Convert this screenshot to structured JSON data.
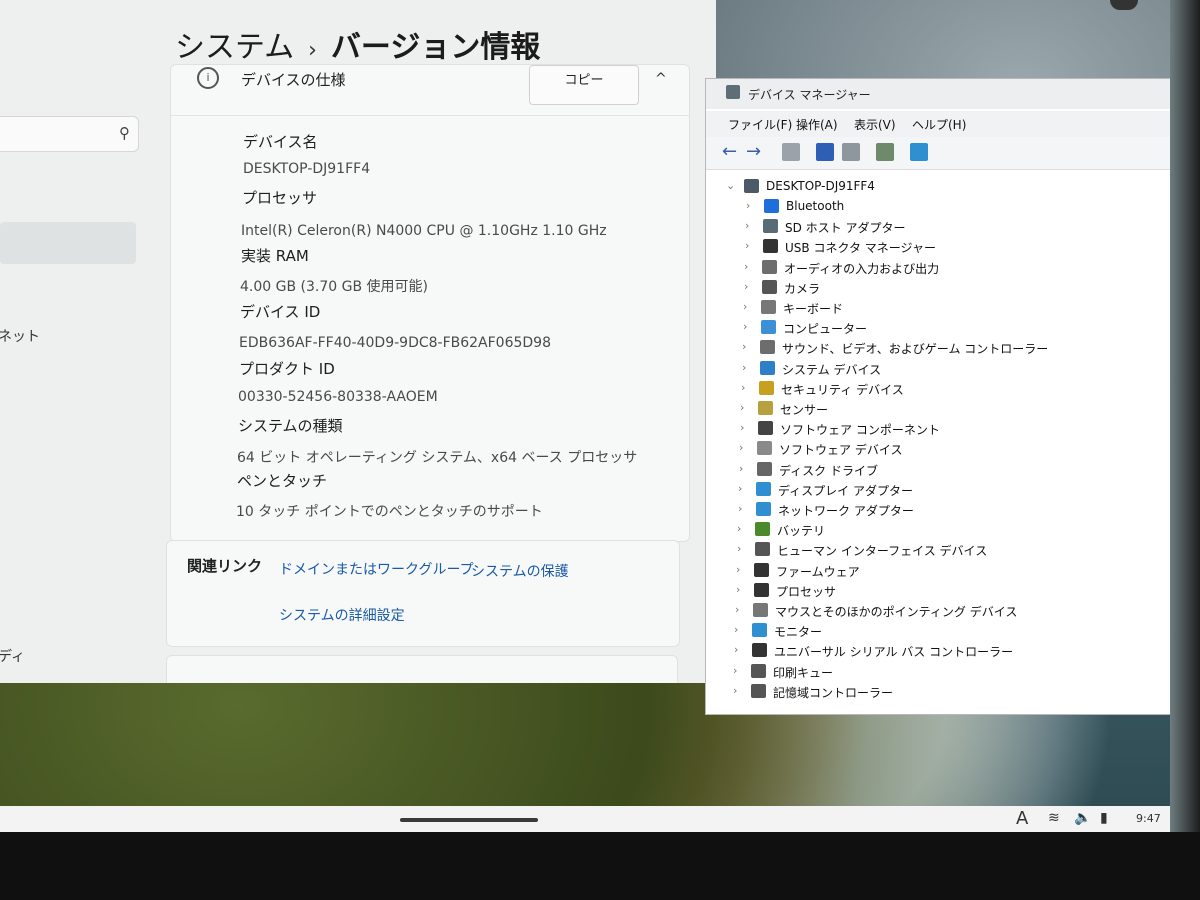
{
  "settings": {
    "breadcrumb": {
      "parent": "システム",
      "separator": "›",
      "current": "バージョン情報"
    },
    "search_icon": "search-icon",
    "nav_fragments": [
      "ネット",
      "ディ"
    ],
    "spec_header": {
      "label": "デバイスの仕様",
      "copy_label": "コピー",
      "chevron": "^"
    },
    "specs": [
      {
        "label": "デバイス名",
        "value": "DESKTOP-DJ91FF4"
      },
      {
        "label": "プロセッサ",
        "value": "Intel(R) Celeron(R) N4000 CPU @ 1.10GHz   1.10 GHz"
      },
      {
        "label": "実装 RAM",
        "value": "4.00 GB (3.70 GB 使用可能)"
      },
      {
        "label": "デバイス ID",
        "value": "EDB636AF-FF40-40D9-9DC8-FB62AF065D98"
      },
      {
        "label": "プロダクト ID",
        "value": "00330-52456-80338-AAOEM"
      },
      {
        "label": "システムの種類",
        "value": "64 ビット オペレーティング システム、x64 ベース プロセッサ"
      },
      {
        "label": "ペンとタッチ",
        "value": "10 タッチ ポイントでのペンとタッチのサポート"
      }
    ],
    "related": {
      "title": "関連リンク",
      "links": [
        "ドメインまたはワークグループ",
        "システムの保護",
        "システムの詳細設定"
      ]
    }
  },
  "device_manager": {
    "title": "デバイス マネージャー",
    "menu": [
      "ファイル(F)",
      "操作(A)",
      "表示(V)",
      "ヘルプ(H)"
    ],
    "toolbar": {
      "back": "←",
      "forward": "→"
    },
    "root": "DESKTOP-DJ91FF4",
    "expander": "›",
    "root_expander": "⌄",
    "devices": [
      {
        "label": "Bluetooth",
        "icon": "bluetooth-icon",
        "color": "#1e6fd9"
      },
      {
        "label": "SD ホスト アダプター",
        "icon": "sd-host-icon",
        "color": "#5a6b78"
      },
      {
        "label": "USB コネクタ マネージャー",
        "icon": "usb-icon",
        "color": "#333333"
      },
      {
        "label": "オーディオの入力および出力",
        "icon": "audio-icon",
        "color": "#6d6d6d"
      },
      {
        "label": "カメラ",
        "icon": "camera-icon",
        "color": "#555555"
      },
      {
        "label": "キーボード",
        "icon": "keyboard-icon",
        "color": "#777777"
      },
      {
        "label": "コンピューター",
        "icon": "computer-icon",
        "color": "#3d8fd6"
      },
      {
        "label": "サウンド、ビデオ、およびゲーム コントローラー",
        "icon": "sound-icon",
        "color": "#6d6d6d"
      },
      {
        "label": "システム デバイス",
        "icon": "system-device-icon",
        "color": "#2f7fc8"
      },
      {
        "label": "セキュリティ デバイス",
        "icon": "security-device-icon",
        "color": "#c8a020"
      },
      {
        "label": "センサー",
        "icon": "sensor-icon",
        "color": "#b8a040"
      },
      {
        "label": "ソフトウェア コンポーネント",
        "icon": "software-component-icon",
        "color": "#444444"
      },
      {
        "label": "ソフトウェア デバイス",
        "icon": "software-device-icon",
        "color": "#8a8a8a"
      },
      {
        "label": "ディスク ドライブ",
        "icon": "disk-drive-icon",
        "color": "#666666"
      },
      {
        "label": "ディスプレイ アダプター",
        "icon": "display-adapter-icon",
        "color": "#2f8fd0"
      },
      {
        "label": "ネットワーク アダプター",
        "icon": "network-adapter-icon",
        "color": "#2f8fd0"
      },
      {
        "label": "バッテリ",
        "icon": "battery-icon",
        "color": "#4a8a2a"
      },
      {
        "label": "ヒューマン インターフェイス デバイス",
        "icon": "hid-icon",
        "color": "#555555"
      },
      {
        "label": "ファームウェア",
        "icon": "firmware-icon",
        "color": "#333333"
      },
      {
        "label": "プロセッサ",
        "icon": "processor-icon",
        "color": "#333333"
      },
      {
        "label": "マウスとそのほかのポインティング デバイス",
        "icon": "mouse-icon",
        "color": "#777777"
      },
      {
        "label": "モニター",
        "icon": "monitor-icon",
        "color": "#2f8fd0"
      },
      {
        "label": "ユニバーサル シリアル バス コントローラー",
        "icon": "usb-controller-icon",
        "color": "#333333"
      },
      {
        "label": "印刷キュー",
        "icon": "print-queue-icon",
        "color": "#555555"
      },
      {
        "label": "記憶域コントローラー",
        "icon": "storage-controller-icon",
        "color": "#555555"
      }
    ]
  },
  "taskbar": {
    "tray": {
      "ime": "A",
      "wifi": "wifi-icon",
      "volume": "volume-icon",
      "battery": "battery-tray-icon"
    },
    "clock": "9:47"
  }
}
